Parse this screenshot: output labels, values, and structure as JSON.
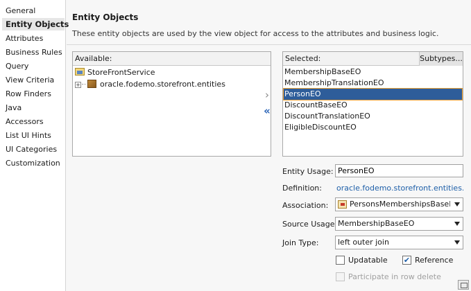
{
  "sidebar": {
    "items": [
      {
        "label": "General",
        "active": false
      },
      {
        "label": "Entity Objects",
        "active": true
      },
      {
        "label": "Attributes",
        "active": false
      },
      {
        "label": "Business Rules",
        "active": false
      },
      {
        "label": "Query",
        "active": false
      },
      {
        "label": "View Criteria",
        "active": false
      },
      {
        "label": "Row Finders",
        "active": false
      },
      {
        "label": "Java",
        "active": false
      },
      {
        "label": "Accessors",
        "active": false
      },
      {
        "label": "List UI Hints",
        "active": false
      },
      {
        "label": "UI Categories",
        "active": false
      },
      {
        "label": "Customization",
        "active": false
      }
    ]
  },
  "page": {
    "title": "Entity Objects",
    "description": "These entity objects are used by the view object for access to the attributes and business logic."
  },
  "available": {
    "header": "Available:",
    "tree": [
      {
        "label": "StoreFrontService",
        "icon": "folder-icon"
      },
      {
        "label": "oracle.fodemo.storefront.entities",
        "icon": "package-icon",
        "expander": "+"
      }
    ]
  },
  "selected": {
    "header": "Selected:",
    "subtypes_label": "Subtypes...",
    "items": [
      "MembershipBaseEO",
      "MembershipTranslationEO",
      "PersonEO",
      "DiscountBaseEO",
      "DiscountTranslationEO",
      "EligibleDiscountEO"
    ],
    "selected_index": 2
  },
  "shuttle": {
    "add_glyph": "›",
    "remove_glyph": "«"
  },
  "details": {
    "entity_usage_label": "Entity Usage:",
    "entity_usage_value": "PersonEO",
    "definition_label": "Definition:",
    "definition_value": "oracle.fodemo.storefront.entities.P...",
    "association_label": "Association:",
    "association_value": "PersonsMembershipsBaseF...",
    "source_usage_label": "Source Usage:",
    "source_usage_value": "MembershipBaseEO",
    "join_type_label": "Join Type:",
    "join_type_value": "left outer join",
    "updatable_label": "Updatable",
    "updatable_checked": false,
    "reference_label": "Reference",
    "reference_checked": true,
    "participate_label": "Participate in row delete",
    "participate_checked": false,
    "check_glyph": "✔"
  },
  "colors": {
    "selection": "#2e5d9a",
    "link": "#1d5ea8",
    "selection_outline": "#f0a030"
  }
}
